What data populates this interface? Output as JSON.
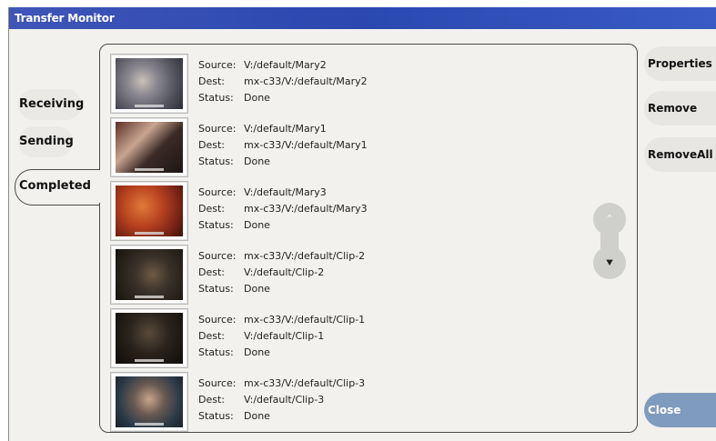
{
  "window": {
    "title": "Transfer Monitor"
  },
  "tabs": [
    {
      "label": "Receiving",
      "selected": false
    },
    {
      "label": "Sending",
      "selected": false
    },
    {
      "label": "Completed",
      "selected": true
    }
  ],
  "labels": {
    "source": "Source:",
    "dest": "Dest:",
    "status": "Status:"
  },
  "transfers": [
    {
      "source": "V:/default/Mary2",
      "dest": "mx-c33/V:/default/Mary2",
      "status": "Done",
      "thumb_color": "#6b6b72"
    },
    {
      "source": "V:/default/Mary1",
      "dest": "mx-c33/V:/default/Mary1",
      "status": "Done",
      "thumb_color": "#3a2a24"
    },
    {
      "source": "V:/default/Mary3",
      "dest": "mx-c33/V:/default/Mary3",
      "status": "Done",
      "thumb_color": "#9a3a1c"
    },
    {
      "source": "mx-c33/V:/default/Clip-2",
      "dest": "V:/default/Clip-2",
      "status": "Done",
      "thumb_color": "#23201c"
    },
    {
      "source": "mx-c33/V:/default/Clip-1",
      "dest": "V:/default/Clip-1",
      "status": "Done",
      "thumb_color": "#1e1a16"
    },
    {
      "source": "mx-c33/V:/default/Clip-3",
      "dest": "V:/default/Clip-3",
      "status": "Done",
      "thumb_color": "#24303a"
    }
  ],
  "scroll": {
    "up_icon": "chevron-up-icon",
    "down_icon": "double-chevron-down-icon"
  },
  "buttons": {
    "properties": "Properties",
    "remove": "Remove",
    "remove_all": "RemoveAll",
    "close": "Close"
  }
}
